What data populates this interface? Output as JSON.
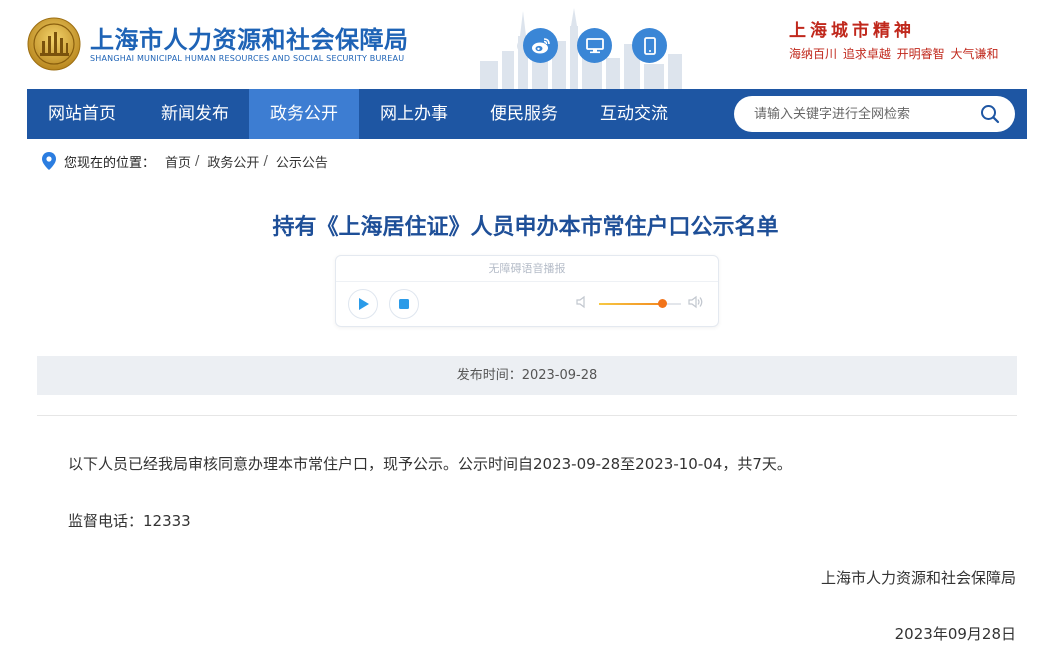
{
  "header": {
    "title": "上海市人力资源和社会保障局",
    "subtitle": "SHANGHAI MUNICIPAL HUMAN RESOURCES AND SOCIAL SECURITY BUREAU",
    "icons": {
      "weibo": "weibo-icon",
      "pc": "monitor-icon",
      "mobile": "mobile-phone-icon"
    },
    "spirit_title": "上海城市精神",
    "spirit_words": "海纳百川  追求卓越  开明睿智  大气谦和"
  },
  "nav": {
    "items": [
      {
        "label": "网站首页",
        "active": false
      },
      {
        "label": "新闻发布",
        "active": false
      },
      {
        "label": "政务公开",
        "active": true
      },
      {
        "label": "网上办事",
        "active": false
      },
      {
        "label": "便民服务",
        "active": false
      },
      {
        "label": "互动交流",
        "active": false
      }
    ],
    "search_placeholder": "请输入关键字进行全网检索",
    "search_value": ""
  },
  "breadcrumb": {
    "label": "您现在的位置：",
    "items": [
      "首页",
      "政务公开",
      "公示公告"
    ],
    "separator": "/"
  },
  "article": {
    "title": "持有《上海居住证》人员申办本市常住户口公示名单",
    "player": {
      "label": "无障碍语音播报",
      "volume": 0.78
    },
    "publish_time": "发布时间：2023-09-28",
    "paragraph1": "以下人员已经我局审核同意办理本市常住户口，现予公示。公示时间自2023-09-28至2023-10-04，共7天。",
    "paragraph2": "监督电话：12333",
    "signature_org": "上海市人力资源和社会保障局",
    "signature_date": "2023年09月28日"
  },
  "colors": {
    "brand_blue": "#1e63b6",
    "nav_bg": "#1e56a3",
    "nav_active": "#3d7dd2",
    "title_blue": "#1e4f98",
    "spirit_red": "#c0281c",
    "volume_orange": "#f2741a"
  }
}
